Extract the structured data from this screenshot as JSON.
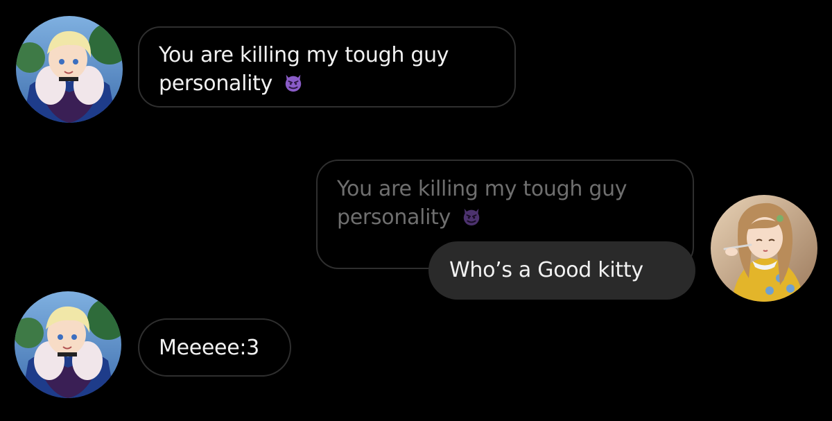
{
  "conversation": {
    "messages": [
      {
        "sender": "left",
        "text": "You are killing my tough guy personality",
        "emoji": "smiling-face-with-horns-icon"
      },
      {
        "sender": "right",
        "quoted": {
          "text": "You are killing my tough guy personality",
          "emoji": "smiling-face-with-horns-icon"
        },
        "text": "Who’s a Good kitty"
      },
      {
        "sender": "left",
        "text": "Meeeee:3"
      }
    ]
  },
  "colors": {
    "background": "#000000",
    "outgoing_bubble": "#2a2a2a",
    "outline": "#2f2f2f",
    "text": "#f2f2f2",
    "quoted_text": "#6f6f6f",
    "emoji": "#8a5cc8"
  }
}
